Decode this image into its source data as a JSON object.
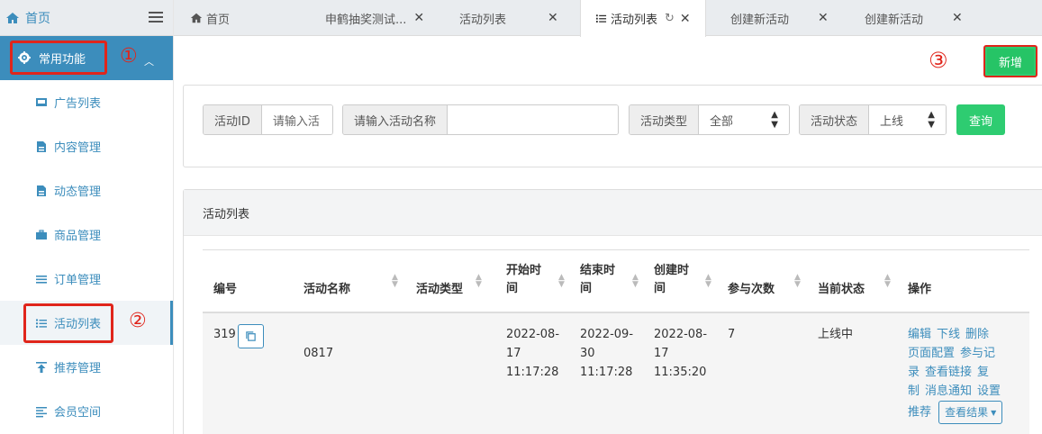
{
  "sidebar": {
    "home_label": "首页",
    "group_label": "常用功能",
    "items": [
      {
        "label": "广告列表"
      },
      {
        "label": "内容管理"
      },
      {
        "label": "动态管理"
      },
      {
        "label": "商品管理"
      },
      {
        "label": "订单管理"
      },
      {
        "label": "活动列表"
      },
      {
        "label": "推荐管理"
      },
      {
        "label": "会员空间"
      }
    ]
  },
  "annotations": {
    "one": "①",
    "two": "②",
    "three": "③"
  },
  "tabs": [
    {
      "label": "首页"
    },
    {
      "label": "申鹤抽奖测试..."
    },
    {
      "label": "活动列表"
    },
    {
      "label": "活动列表"
    },
    {
      "label": "创建新活动"
    },
    {
      "label": "创建新活动"
    }
  ],
  "toolbar": {
    "add_label": "新增"
  },
  "filters": {
    "id_label": "活动ID",
    "id_placeholder": "请输入活",
    "name_label": "请输入活动名称",
    "type_label": "活动类型",
    "type_value": "全部",
    "status_label": "活动状态",
    "status_value": "上线",
    "query_label": "查询"
  },
  "list": {
    "title": "活动列表",
    "columns": [
      "编号",
      "活动名称",
      "活动类型",
      "开始时间",
      "结束时间",
      "创建时间",
      "参与次数",
      "当前状态",
      "操作"
    ],
    "col_wrap": {
      "start": [
        "开始时",
        "间"
      ],
      "end": [
        "结束时",
        "间"
      ],
      "created": [
        "创建时",
        "间"
      ]
    },
    "rows": [
      {
        "id": "319",
        "name": "0817",
        "type": "",
        "start": [
          "2022-08-",
          "17",
          "11:17:28"
        ],
        "end": [
          "2022-09-",
          "30",
          "11:17:28"
        ],
        "created": [
          "2022-08-",
          "17",
          "11:35:20"
        ],
        "count": "7",
        "status": "上线中",
        "ops": [
          "编辑",
          "下线",
          "删除",
          "页面配置",
          "参与记",
          "录",
          "查看链接",
          "复",
          "制",
          "消息通知",
          "设置",
          "推荐"
        ],
        "result_btn": "查看结果"
      }
    ]
  }
}
